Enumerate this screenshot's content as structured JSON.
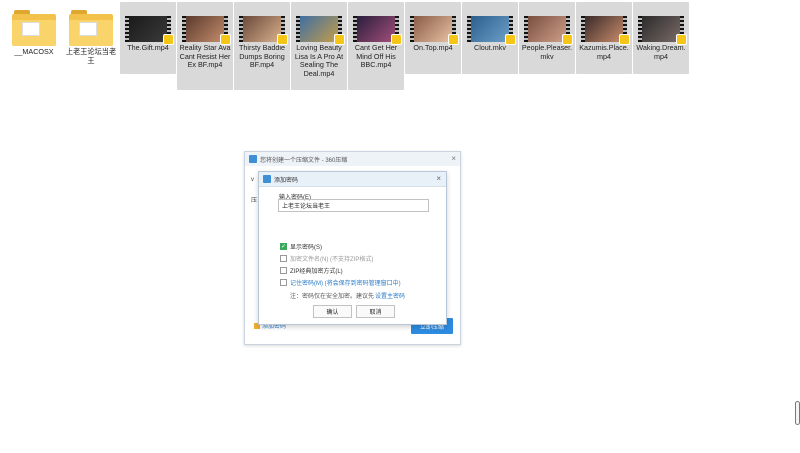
{
  "files": [
    {
      "name": "__MACOSX",
      "type": "folder"
    },
    {
      "name": "上老王论坛当老王",
      "type": "folder"
    },
    {
      "name": "The.Gift.mp4",
      "type": "video"
    },
    {
      "name": "Reality Star Ava Cant Resist Her Ex BF.mp4",
      "type": "video"
    },
    {
      "name": "Thirsty Baddie Dumps Boring BF.mp4",
      "type": "video"
    },
    {
      "name": "Loving Beauty Lisa Is A Pro At Sealing The Deal.mp4",
      "type": "video"
    },
    {
      "name": "Cant Get Her Mind Off His BBC.mp4",
      "type": "video"
    },
    {
      "name": "On.Top.mp4",
      "type": "video"
    },
    {
      "name": "Clout.mkv",
      "type": "video"
    },
    {
      "name": "People.Pleaser.mkv",
      "type": "video"
    },
    {
      "name": "Kazumis.Place.mp4",
      "type": "video"
    },
    {
      "name": "Waking.Dream.mp4",
      "type": "video"
    }
  ],
  "main_dialog": {
    "title": "您将创建一个压缩文件 - 360压缩",
    "close": "×",
    "side_label_1": "v",
    "side_label_2": "压",
    "add_password": "添加密码",
    "start_button": "立即压缩"
  },
  "password_dialog": {
    "title": "添加密码",
    "close": "×",
    "input_label": "输入密码(E)",
    "password_value": "上老王论坛当老王",
    "options": {
      "show_password": "显示密码(S)",
      "encrypt_filenames": "加密文件名(N) (不支持ZIP格式)",
      "zip_classic": "ZIP经典加密方式(L)",
      "remember": "记住密码(M) (将会保存到密码管理窗口中)",
      "note_prefix": "注：密码仅在安全加密。建议先",
      "note_link": "设置主密码"
    },
    "ok": "确认",
    "cancel": "取消"
  },
  "colors": {
    "accent": "#2d8be0",
    "check": "#3aa85a",
    "folder": "#f3c24b"
  }
}
